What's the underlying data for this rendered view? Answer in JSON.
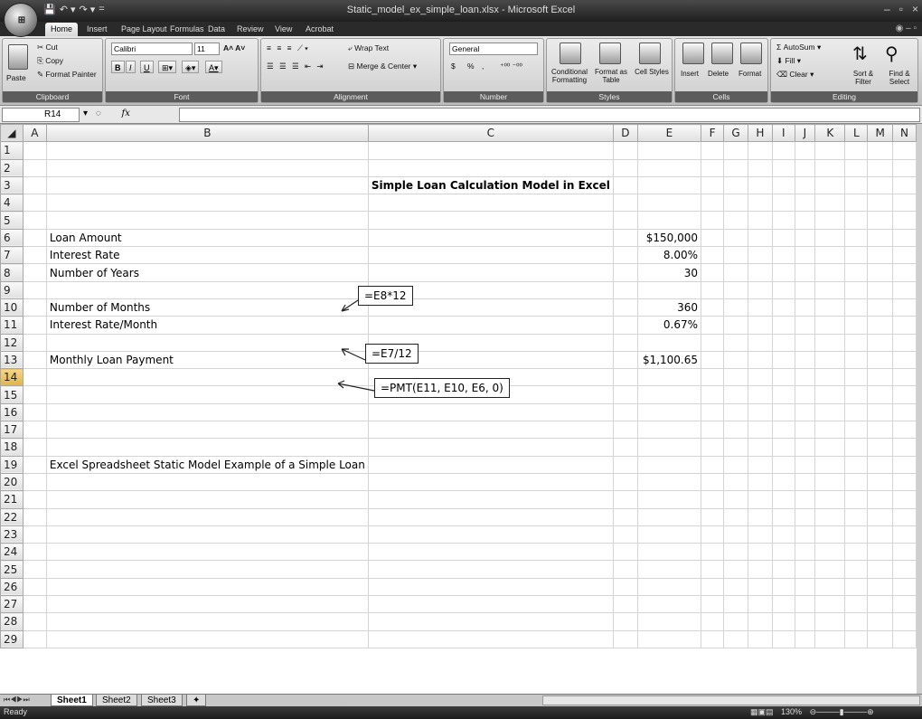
{
  "app": {
    "window_title": "Static_model_ex_simple_loan.xlsx - Microsoft Excel",
    "office_button_label": "⊞",
    "qat": [
      "💾",
      "↶ ▾",
      "↷ ▾",
      "="
    ]
  },
  "tabs": [
    "Home",
    "Insert",
    "Page Layout",
    "Formulas",
    "Data",
    "Review",
    "View",
    "Acrobat"
  ],
  "ribbon": {
    "clipboard": {
      "paste": "Paste",
      "cut": "Cut",
      "copy": "Copy",
      "format_painter": "Format Painter",
      "label": "Clipboard"
    },
    "font": {
      "name": "Calibri",
      "size": "11",
      "bold": "B",
      "italic": "I",
      "underline": "U",
      "label": "Font"
    },
    "alignment": {
      "wrap": "Wrap Text",
      "merge": "Merge & Center",
      "label": "Alignment"
    },
    "number": {
      "format": "General",
      "currency": "$",
      "percent": "%",
      "comma": ",",
      "label": "Number"
    },
    "styles": {
      "conditional": "Conditional Formatting",
      "format_table": "Format as Table",
      "cell_styles": "Cell Styles",
      "label": "Styles"
    },
    "cells": {
      "insert": "Insert",
      "delete": "Delete",
      "format": "Format",
      "label": "Cells"
    },
    "editing": {
      "autosum": "AutoSum",
      "fill": "Fill",
      "clear": "Clear",
      "sort": "Sort & Filter",
      "find": "Find & Select",
      "label": "Editing"
    }
  },
  "formula_bar": {
    "name_box": "R14",
    "fx": "fx",
    "value": ""
  },
  "grid": {
    "columns": [
      "A",
      "B",
      "C",
      "D",
      "E",
      "F",
      "G",
      "H",
      "I",
      "J",
      "K",
      "L",
      "M",
      "N"
    ],
    "rows": [
      "1",
      "2",
      "3",
      "4",
      "5",
      "6",
      "7",
      "8",
      "9",
      "10",
      "11",
      "12",
      "13",
      "14",
      "15",
      "16",
      "17",
      "18",
      "19",
      "20",
      "21",
      "22",
      "23",
      "24",
      "25",
      "26",
      "27",
      "28",
      "29"
    ],
    "cells": {
      "title": "Simple Loan Calculation Model in Excel",
      "loan_amount_label": "Loan Amount",
      "loan_amount_value": "$150,000",
      "interest_rate_label": "Interest Rate",
      "interest_rate_value": "8.00%",
      "years_label": "Number of Years",
      "years_value": "30",
      "months_label": "Number of Months",
      "months_value": "360",
      "rate_month_label": "Interest Rate/Month",
      "rate_month_value": "0.67%",
      "payment_label": "Monthly Loan Payment",
      "payment_value": "$1,100.65",
      "footer_text": "Excel Spreadsheet Static Model Example of a Simple Loan"
    }
  },
  "callouts": {
    "c1": "=E8*12",
    "c2": "=E7/12",
    "c3": "=PMT(E11, E10, E6, 0)"
  },
  "sheets": [
    "Sheet1",
    "Sheet2",
    "Sheet3"
  ],
  "status": {
    "text": "Ready",
    "zoom": "130%"
  }
}
